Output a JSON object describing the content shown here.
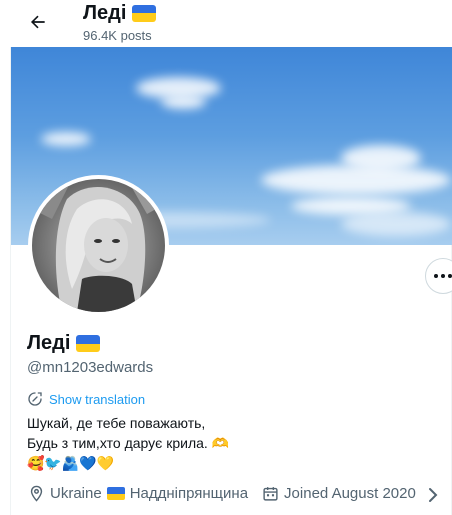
{
  "header": {
    "title": "Леді",
    "posts": "96.4K posts"
  },
  "profile": {
    "name": "Леді",
    "handle": "@mn1203edwards",
    "show_translation": "Show translation",
    "bio_line1": "Шукай, де тебе поважають,",
    "bio_line2": "Будь з тим,хто дарує крила.",
    "bio_line2_emoji": "🫶",
    "bio_line3_emoji": "🥰🐦🫂💙💛",
    "location": "Ukraine",
    "location_region": "Наддніпрянщина",
    "joined": "Joined August 2020"
  },
  "icons": {
    "back": "arrow-left-icon",
    "more": "more-dots-icon",
    "translate": "translate-icon",
    "location": "location-pin-icon",
    "calendar": "calendar-icon",
    "chevron": "chevron-right-icon"
  },
  "colors": {
    "accent": "#1d9bf0",
    "secondary_text": "#536471",
    "flag_blue": "#2f6fe0",
    "flag_yellow": "#ffcc1a"
  }
}
